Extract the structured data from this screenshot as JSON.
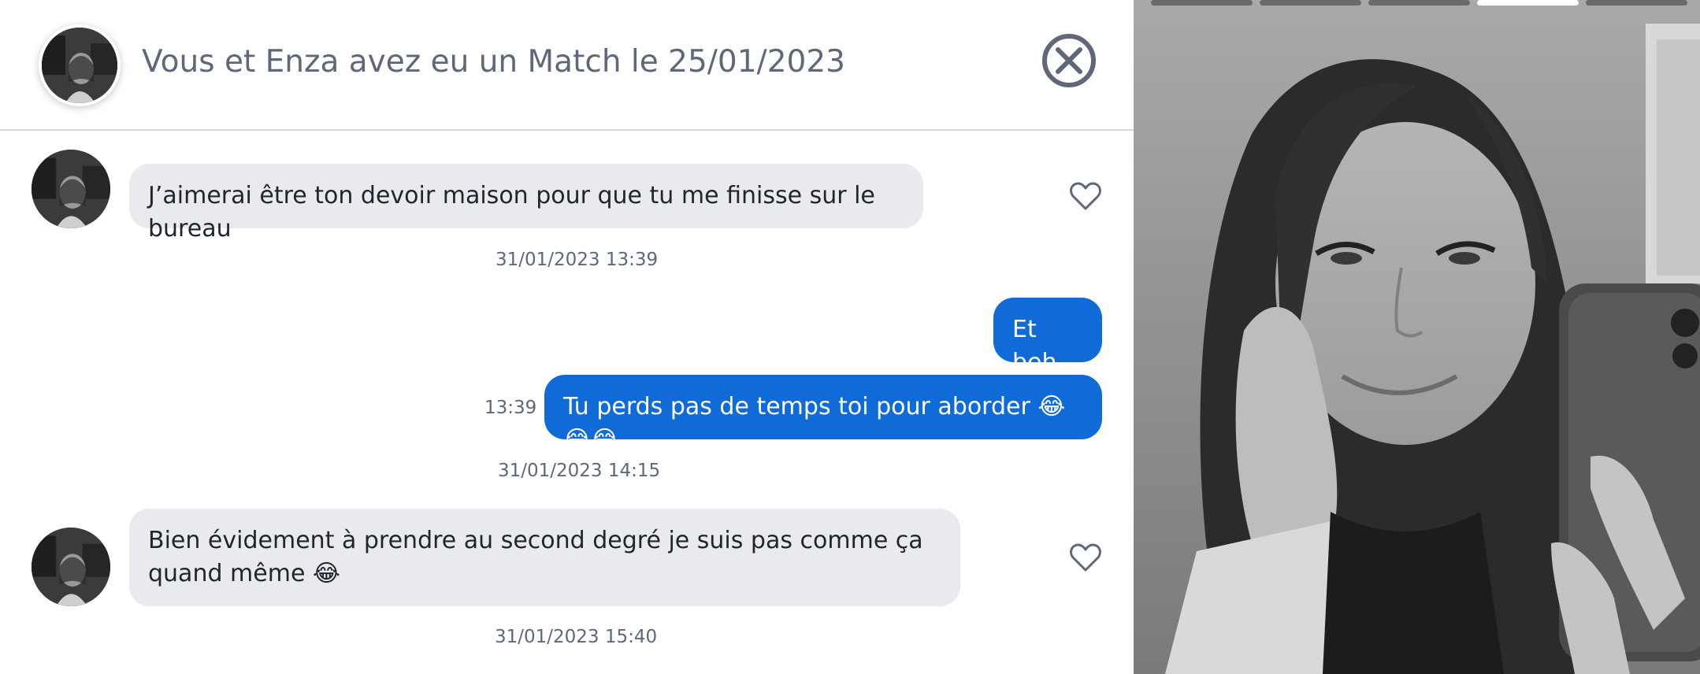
{
  "header": {
    "title": "Vous et Enza avez eu un Match le 25/01/2023",
    "avatar_icon": "profile-photo",
    "close_icon": "close-circle-icon"
  },
  "messages": [
    {
      "side": "incoming",
      "text": "J’aimerai être ton devoir maison pour que tu me finisse sur le bureau",
      "date": "31/01/2023 13:39"
    },
    {
      "side": "outgoing",
      "text": "Et beh"
    },
    {
      "side": "outgoing",
      "text": "Tu perds pas de temps toi pour aborder 😂😂😂",
      "time": "13:39",
      "date": "31/01/2023 14:15"
    },
    {
      "side": "incoming",
      "text": "Bien évidement à prendre au second degré je suis pas comme ça quand même 😂",
      "date": "31/01/2023 15:40"
    }
  ],
  "photo": {
    "indicator_count": 5,
    "active_index": 3
  },
  "colors": {
    "outgoing_bubble": "#106bd9",
    "incoming_bubble": "#e9eaee",
    "meta_text": "#5f6778"
  }
}
